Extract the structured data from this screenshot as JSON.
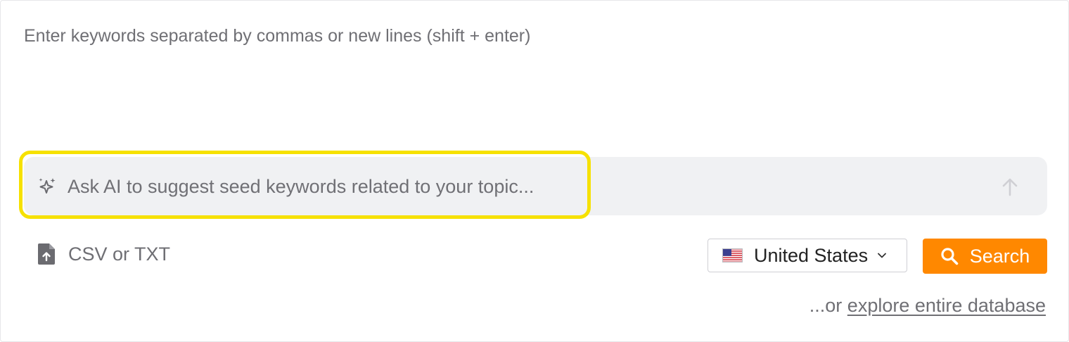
{
  "keywords": {
    "placeholder": "Enter keywords separated by commas or new lines (shift + enter)",
    "value": ""
  },
  "ai": {
    "placeholder": "Ask AI to suggest seed keywords related to your topic...",
    "value": "",
    "highlight_color": "#f6e100",
    "bar_color": "#f0f1f3"
  },
  "upload": {
    "label": "CSV or TXT",
    "icon": "file-upload-icon"
  },
  "country": {
    "selected": "United States",
    "flag": "us-flag-icon"
  },
  "search": {
    "label": "Search",
    "icon": "magnifier-icon",
    "color": "#ff8800"
  },
  "explore": {
    "prefix": "...or ",
    "link": "explore entire database"
  }
}
